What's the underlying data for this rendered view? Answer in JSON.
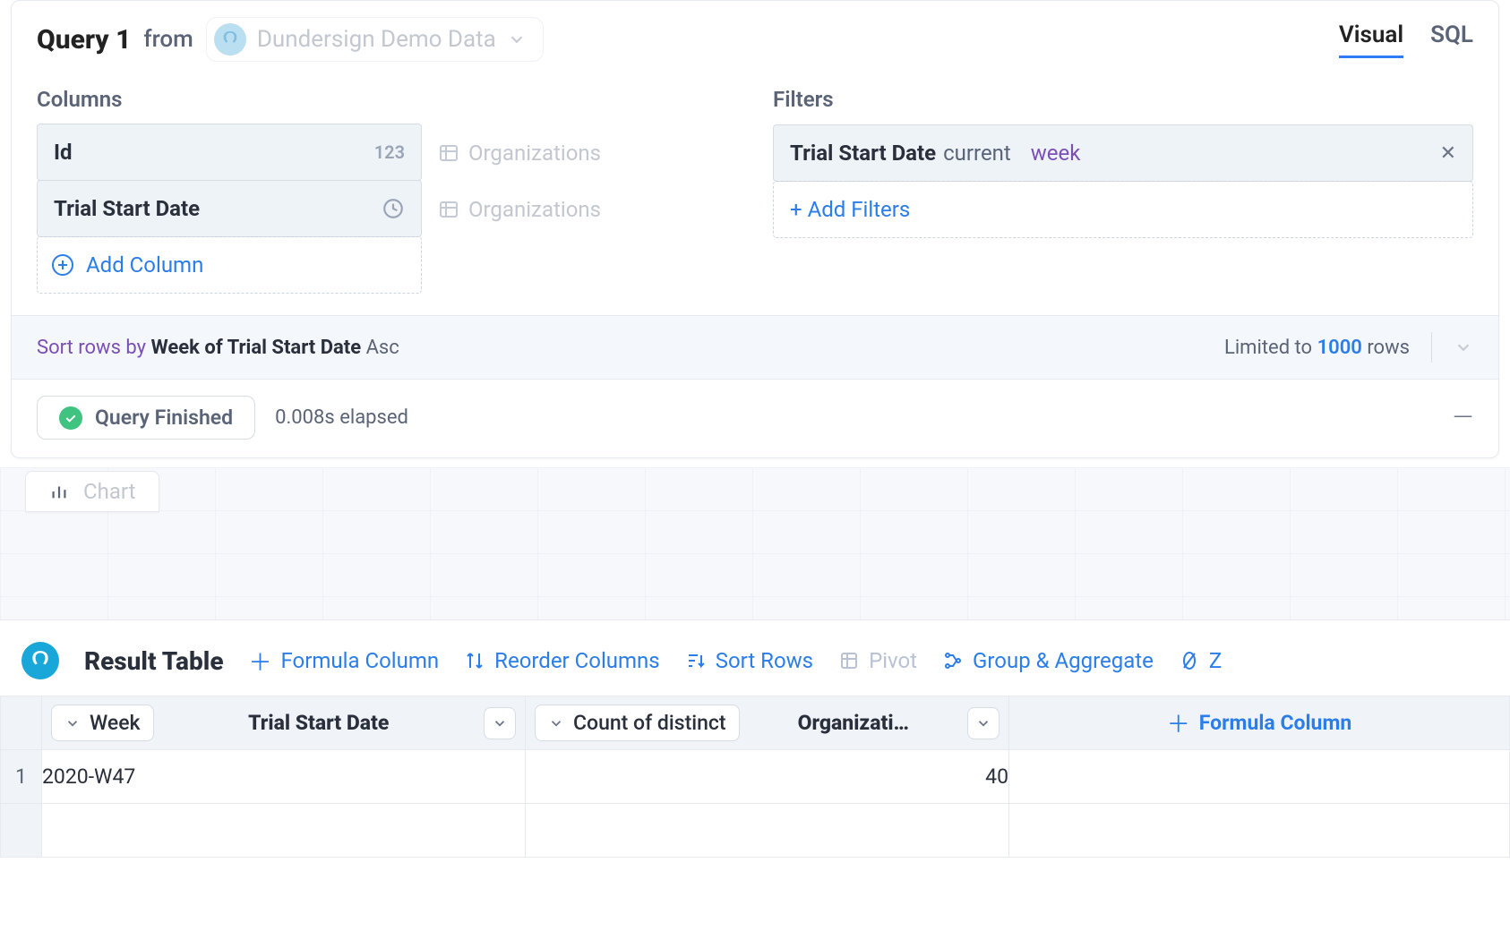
{
  "header": {
    "query_title": "Query 1",
    "from_word": "from",
    "datasource": "Dundersign Demo Data",
    "tabs": {
      "visual": "Visual",
      "sql": "SQL",
      "active": "visual"
    }
  },
  "columns": {
    "title": "Columns",
    "items": [
      {
        "name": "Id",
        "type_tag": "123",
        "source": "Organizations"
      },
      {
        "name": "Trial Start Date",
        "type_tag": "time",
        "source": "Organizations"
      }
    ],
    "add_label": "Add Column"
  },
  "filters": {
    "title": "Filters",
    "items": [
      {
        "field": "Trial Start Date",
        "op": "current",
        "value": "week"
      }
    ],
    "add_label": "+ Add Filters"
  },
  "sort": {
    "prefix": "Sort rows by",
    "field": "Week of Trial Start Date",
    "direction": "Asc",
    "limit_prefix": "Limited to",
    "limit_value": "1000",
    "limit_suffix": "rows"
  },
  "status": {
    "label": "Query Finished",
    "elapsed": "0.008s elapsed"
  },
  "chart": {
    "tab_label": "Chart"
  },
  "result": {
    "title": "Result Table",
    "tools": {
      "formula": "Formula Column",
      "reorder": "Reorder Columns",
      "sort": "Sort Rows",
      "pivot": "Pivot",
      "group": "Group & Aggregate",
      "zero_partial": "Z"
    },
    "headers": {
      "col1_agg": "Week",
      "col1_field": "Trial Start Date",
      "col2_agg": "Count of distinct",
      "col2_field": "Organizati…",
      "formula": "Formula Column"
    },
    "rows": [
      {
        "n": "1",
        "week": "2020-W47",
        "count": "40"
      }
    ]
  }
}
